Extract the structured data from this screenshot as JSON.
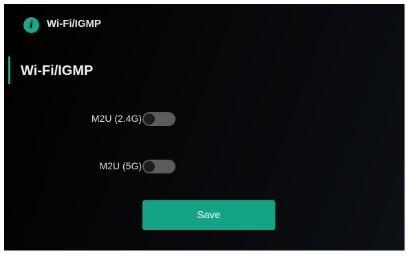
{
  "header": {
    "icon": "info-icon",
    "icon_glyph": "i",
    "title": "Wi-Fi/IGMP"
  },
  "section": {
    "title": "Wi-Fi/IGMP"
  },
  "settings": [
    {
      "label": "M2U (2.4G)",
      "enabled": false
    },
    {
      "label": "M2U (5G)",
      "enabled": false
    }
  ],
  "actions": {
    "save_label": "Save"
  },
  "colors": {
    "accent": "#14a386",
    "toggle_off": "#5c5c5c",
    "background": "#000000"
  }
}
